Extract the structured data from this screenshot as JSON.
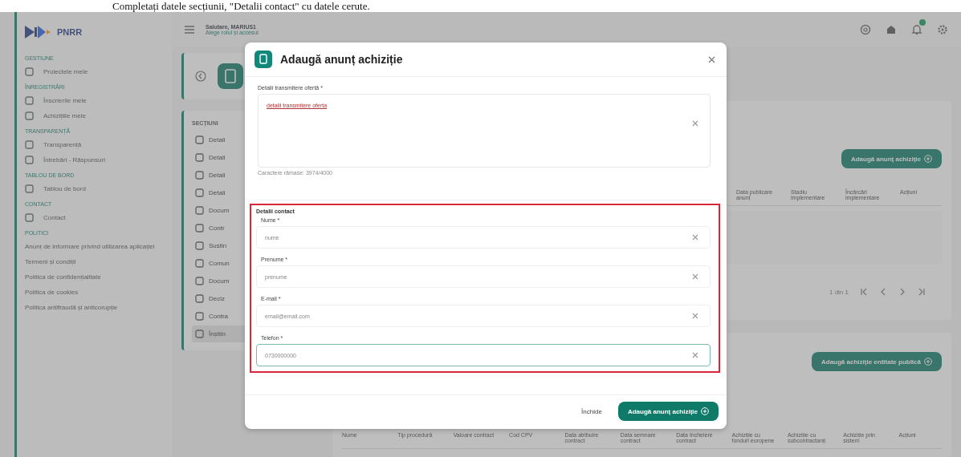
{
  "caption": "Completați datele secțiunii, \"Detalii contact\" cu datele cerute.",
  "sidebar": {
    "logo": "PNRR",
    "groups": [
      {
        "title": "GESTIUNE",
        "items": [
          "Proiectele mele"
        ]
      },
      {
        "title": "ÎNREGISTRĂRI",
        "items": [
          "Înscrierile mele",
          "Achizițiile mele"
        ]
      },
      {
        "title": "TRANSPARENȚĂ",
        "items": [
          "Transparență",
          "Întrebări - Răspunsuri"
        ]
      },
      {
        "title": "TABLOU DE BORD",
        "items": [
          "Tablou de bord"
        ]
      },
      {
        "title": "CONTACT",
        "items": [
          "Contact"
        ]
      },
      {
        "title": "POLITICI",
        "links": [
          "Anunț de informare privind utilizarea aplicației",
          "Termeni și condiții",
          "Politica de confidențialitate",
          "Politica de cookies",
          "Politica antifraudă și anticorupție"
        ]
      }
    ]
  },
  "header": {
    "greeting": "Salutare, MARIUS1",
    "subtitle": "Alege rolul și accesul",
    "notification_badge": true
  },
  "sections": {
    "title": "SECȚIUNI",
    "items": [
      {
        "label": "Detali",
        "selected": false
      },
      {
        "label": "Detali",
        "selected": false
      },
      {
        "label": "Detali",
        "selected": false
      },
      {
        "label": "Detali",
        "selected": false
      },
      {
        "label": "Docum",
        "selected": false
      },
      {
        "label": "Contr",
        "selected": false
      },
      {
        "label": "Sustin",
        "selected": false
      },
      {
        "label": "Comun",
        "selected": false
      },
      {
        "label": "Docum",
        "selected": false
      },
      {
        "label": "Deciz",
        "selected": false
      },
      {
        "label": "Contra",
        "selected": false
      },
      {
        "label": "Înștiin",
        "selected": true
      }
    ]
  },
  "announcements": {
    "add_button": "Adaugă anunț achiziție",
    "columns": [
      "Data publicare anunț",
      "Stadiu implementare",
      "Încărcări implementare",
      "Acțiuni"
    ],
    "pagination": "1 din 1"
  },
  "public_entity": {
    "add_button": "Adaugă achiziție entitate publică",
    "columns": [
      "Nume",
      "Tip procedură",
      "Valoare contract",
      "Cod CPV",
      "Data atribuire contract",
      "Data semnare contract",
      "Data încheiere contract",
      "Achiziție cu fonduri europene",
      "Achiziție cu subcontractanți",
      "Achiziție prin sistem",
      "Acțiuni"
    ]
  },
  "modal": {
    "title": "Adaugă anunț achiziție",
    "offer": {
      "label": "Detalii transmitere ofertă *",
      "value": "detalii transmitere oferta",
      "hint": "Caractere rămase: 3974/4000"
    },
    "contact": {
      "title": "Detalii contact",
      "fields": [
        {
          "label": "Nume *",
          "value": "nume",
          "focused": false
        },
        {
          "label": "Prenume *",
          "value": "prenume",
          "focused": false
        },
        {
          "label": "E-mail *",
          "value": "email@email.com",
          "focused": false
        },
        {
          "label": "Telefon *",
          "value": "0730000000",
          "focused": true
        }
      ]
    },
    "cancel": "Închide",
    "submit": "Adaugă anunț achiziție"
  }
}
